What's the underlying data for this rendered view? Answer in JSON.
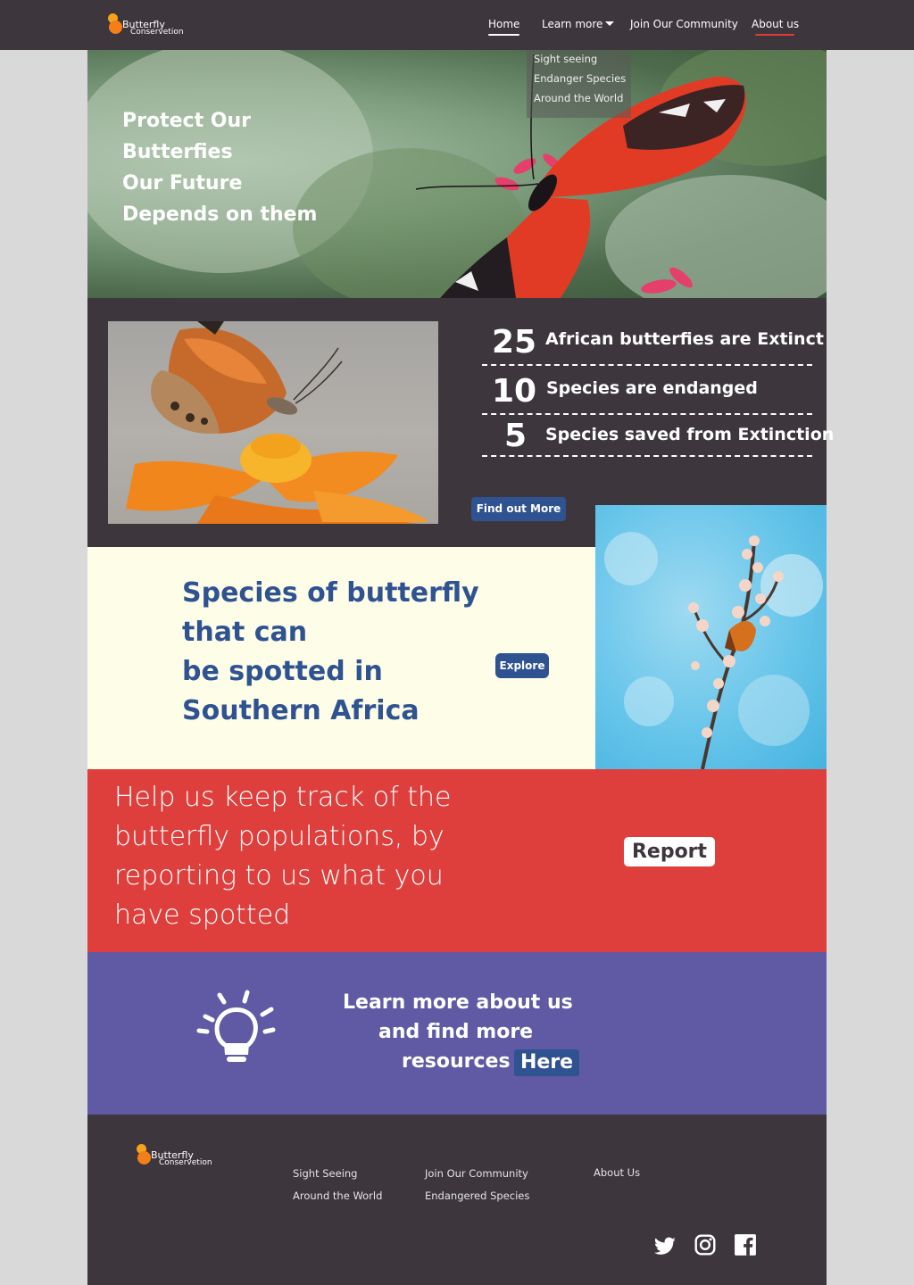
{
  "brand": {
    "line1": "Butterfly",
    "line2": "Conservetion"
  },
  "nav": {
    "home": "Home",
    "learn_more": "Learn more",
    "join": "Join Our Community",
    "about": "About us",
    "dropdown": [
      "Sight seeing",
      "Endanger Species",
      "Around the World"
    ]
  },
  "hero": {
    "lines": [
      "Protect Our",
      "Butterfies",
      "Our Future",
      "Depends on them"
    ]
  },
  "stats": [
    {
      "number": "25",
      "text": "African butterfies are Extinct"
    },
    {
      "number": "10",
      "text": "Species are endanged"
    },
    {
      "number": "5",
      "text": "Species saved from Extinction"
    }
  ],
  "find_out_more": "Find out More",
  "species": {
    "lines": [
      "Species of butterfly",
      "that can",
      "be spotted in",
      "Southern Africa"
    ],
    "explore": "Explore"
  },
  "report": {
    "lines": [
      "Help us keep track of the",
      "butterfly populations, by",
      "reporting to us what you",
      "have spotted"
    ],
    "button": "Report"
  },
  "learn": {
    "line1": "Learn more about us",
    "line2": "and find more",
    "line3": "resources",
    "here": "Here"
  },
  "footer": {
    "col1": [
      "Sight Seeing",
      "Around  the World"
    ],
    "col2": [
      "Join Our Community",
      "Endangered Species"
    ],
    "about": "About Us",
    "social": [
      "twitter-icon",
      "instagram-icon",
      "facebook-icon"
    ]
  },
  "colors": {
    "dark": "#3d363c",
    "blue": "#2f5291",
    "cream": "#fdfde8",
    "red": "#de3f3c",
    "purple": "#605aa5",
    "underline_red": "#e03b3b"
  }
}
